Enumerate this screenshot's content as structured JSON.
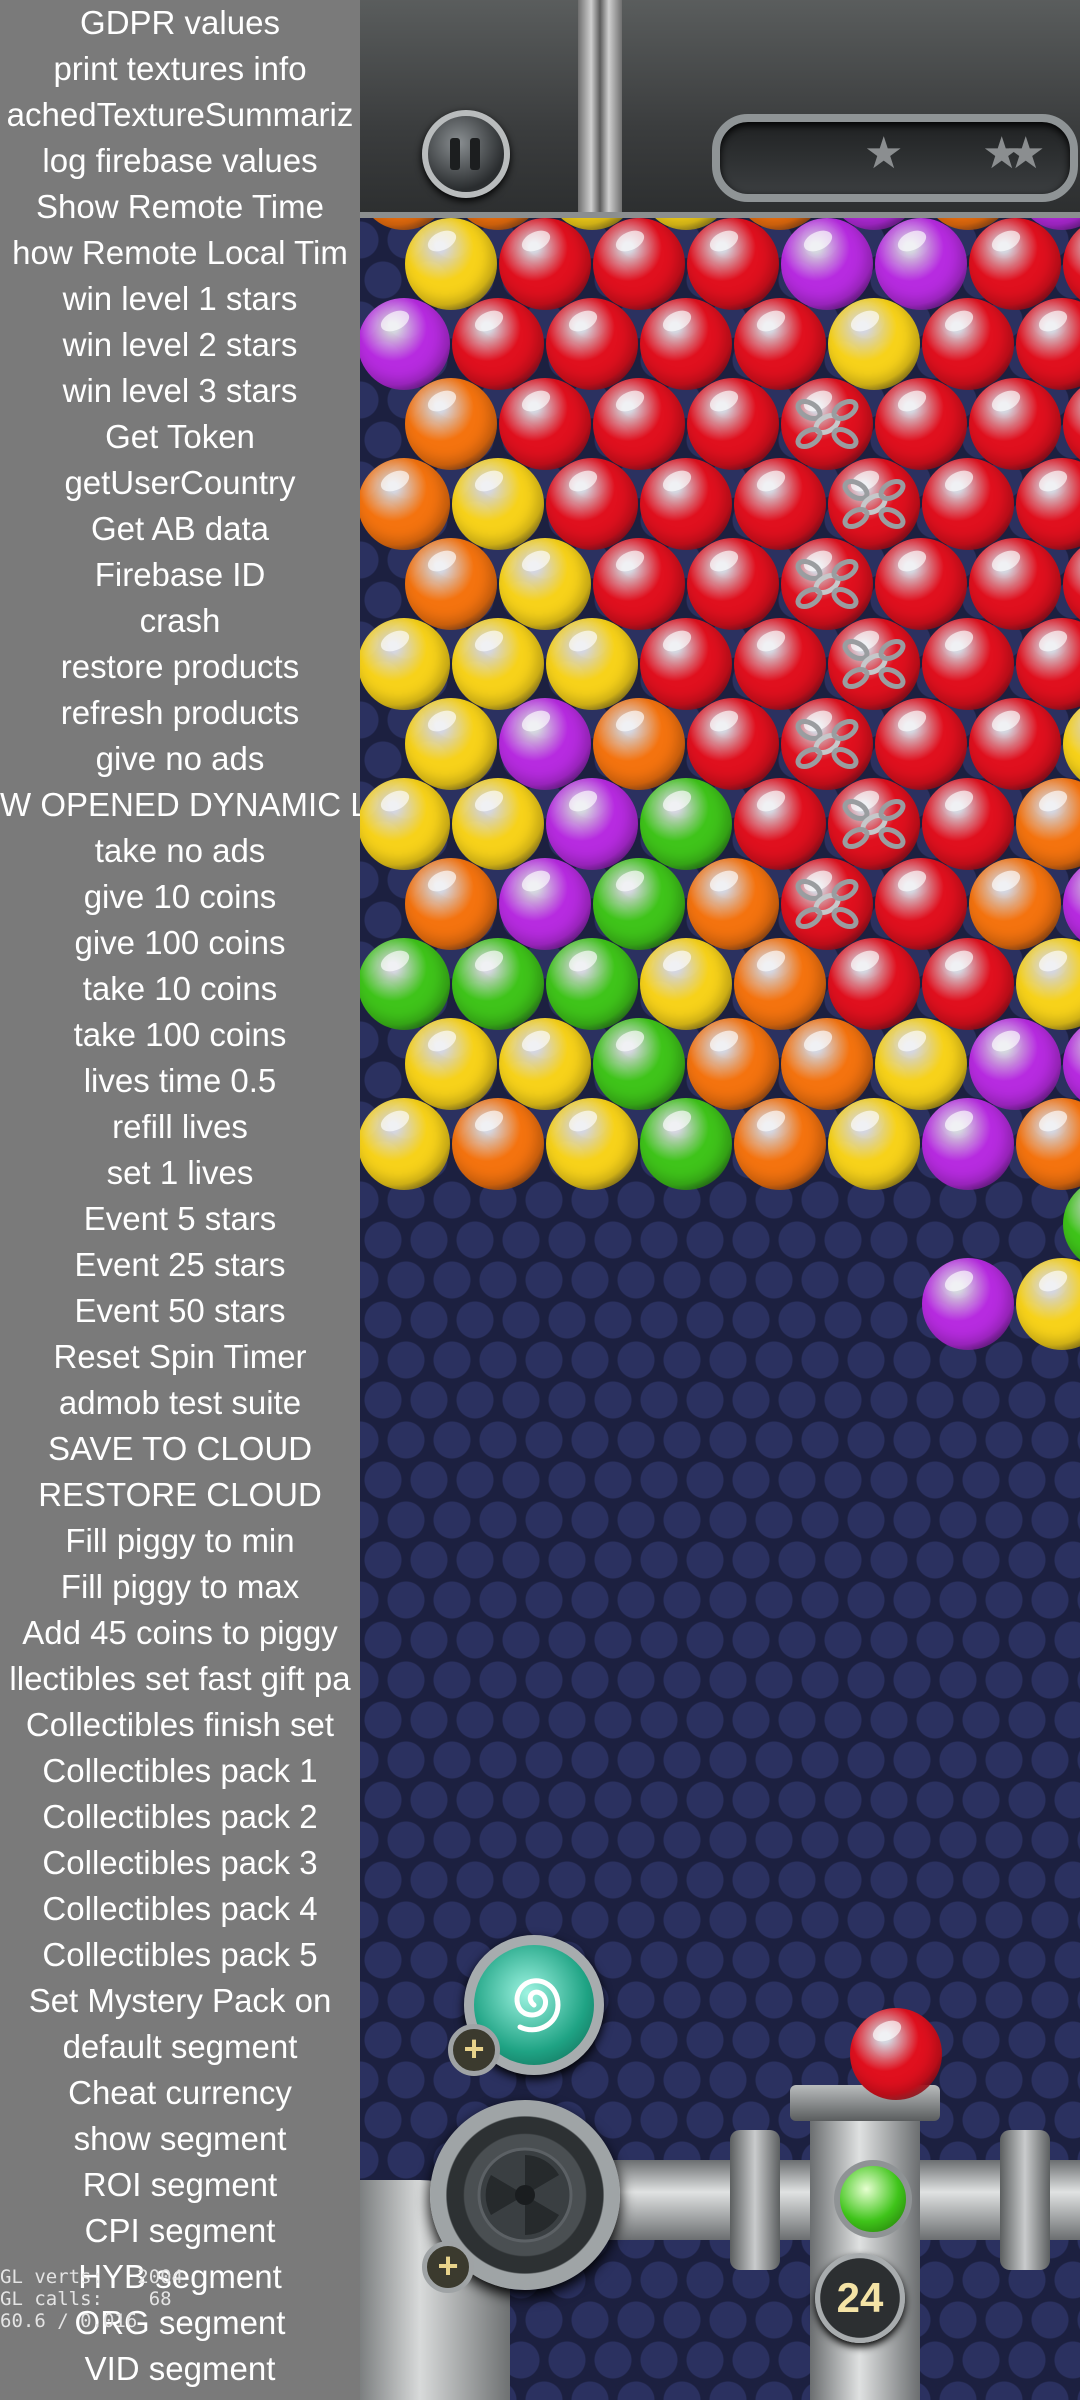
{
  "debug_menu": {
    "items": [
      "GDPR values",
      "print textures info",
      "achedTextureSummariz",
      "log firebase values",
      "Show Remote Time",
      "how Remote Local Tim",
      "win level 1 stars",
      "win level 2 stars",
      "win level 3 stars",
      "Get Token",
      "getUserCountry",
      "Get AB data",
      "Firebase ID",
      "crash",
      "restore products",
      "refresh products",
      "give no ads",
      "W OPENED DYNAMIC L",
      "take no ads",
      "give 10 coins",
      "give 100 coins",
      "take 10 coins",
      "take 100 coins",
      "lives time 0.5",
      "refill lives",
      "set 1 lives",
      "Event 5 stars",
      "Event 25 stars",
      "Event 50 stars",
      "Reset Spin Timer",
      "admob test suite",
      "SAVE TO CLOUD",
      "RESTORE CLOUD",
      "Fill piggy to min",
      "Fill piggy to max",
      "Add 45 coins to piggy",
      "llectibles set fast gift pa",
      "Collectibles finish set",
      "Collectibles pack 1",
      "Collectibles pack 2",
      "Collectibles pack 3",
      "Collectibles pack 4",
      "Collectibles pack 5",
      "Set Mystery Pack on",
      "default segment",
      "Cheat currency",
      "show segment",
      "ROI segment",
      "CPI segment",
      "HYB segment",
      "ORG segment",
      "VID segment"
    ]
  },
  "gl_stats": {
    "line1": "GL verts:   2004",
    "line2": "GL calls:    68",
    "line3": "60.6 / 0.016"
  },
  "game": {
    "moves_remaining": "24",
    "stars_earned": 0,
    "stars_total": 3,
    "star_glyph": "★",
    "plus_glyph": "+",
    "colors": {
      "red": "#e0101e",
      "yellow": "#f7d21a",
      "orange": "#f4730f",
      "purple": "#b72be0",
      "green": "#3fc41a"
    },
    "bubble_rows": [
      "OOYYOPOP",
      "YRRRPPRR",
      "PRRRRYRR",
      "ORRRRRRR",
      "OYRRRRRR",
      "OYRRRRRR",
      "YYYRRRRR",
      "YPORRRRY",
      "YYPGRRRO",
      "OPGORROP",
      "GGGYORRY",
      "YYGOOYPP",
      "YOYGOYPO",
      "-------G",
      "------PY"
    ],
    "chained_cells": [
      [
        3,
        4
      ],
      [
        4,
        5
      ],
      [
        5,
        4
      ],
      [
        6,
        5
      ],
      [
        7,
        4
      ],
      [
        8,
        5
      ],
      [
        9,
        4
      ]
    ],
    "shooter_bubble": "red",
    "next_bubble": "green",
    "icons": [
      "pause-icon",
      "star-icon",
      "booster-swirl-icon",
      "plus-icon",
      "cannon-fan-icon",
      "chain-lock-icon"
    ]
  }
}
